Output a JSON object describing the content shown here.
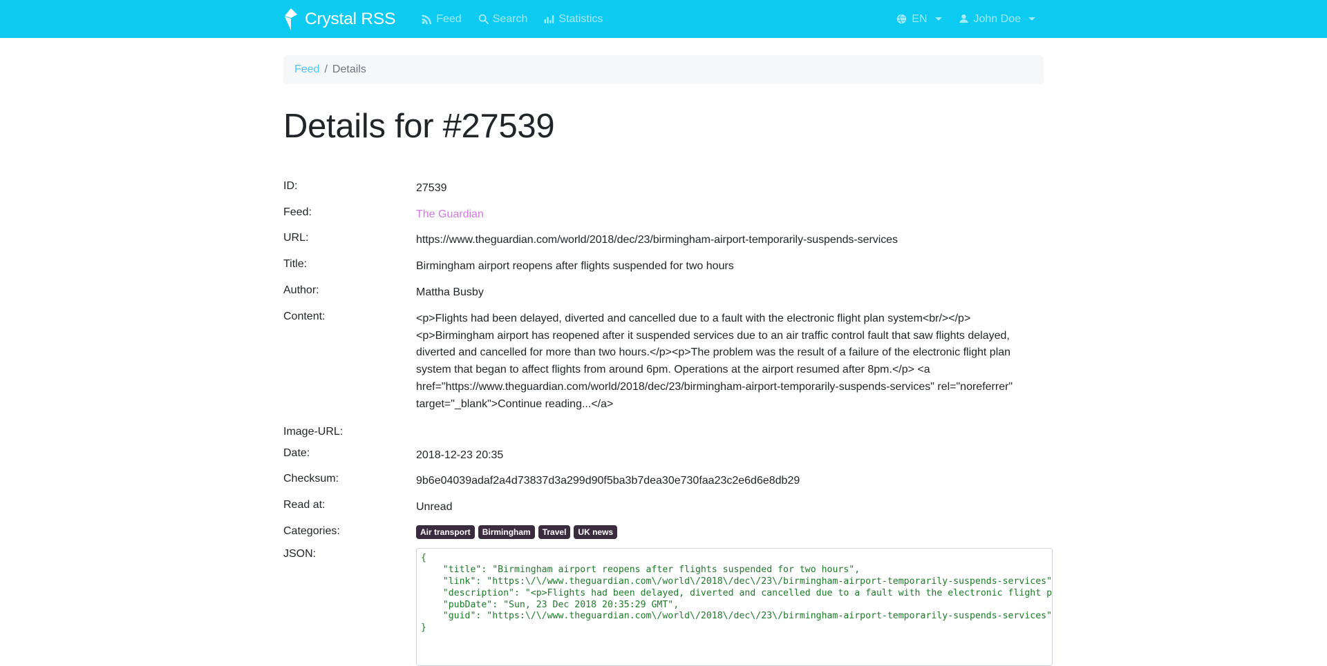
{
  "navbar": {
    "brand": "Crystal RSS",
    "brand_icon": "crystal-logo-icon",
    "links": [
      {
        "label": "Feed",
        "icon": "rss-feed-icon"
      },
      {
        "label": "Search",
        "icon": "search-icon"
      },
      {
        "label": "Statistics",
        "icon": "bar-chart-icon"
      }
    ],
    "language": {
      "label": "EN",
      "icon": "globe-icon"
    },
    "user": {
      "label": "John Doe",
      "icon": "user-icon"
    },
    "background_color": "#0dcaf0"
  },
  "breadcrumb": {
    "parent": "Feed",
    "separator": "/",
    "current": "Details"
  },
  "page": {
    "title": "Details for #27539"
  },
  "details": {
    "labels": {
      "id": "ID:",
      "feed": "Feed:",
      "url": "URL:",
      "title": "Title:",
      "author": "Author:",
      "content": "Content:",
      "image_url": "Image-URL:",
      "date": "Date:",
      "checksum": "Checksum:",
      "read_at": "Read at:",
      "categories": "Categories:",
      "json": "JSON:"
    },
    "id": "27539",
    "feed": "The Guardian",
    "feed_link_color": "#d17ae0",
    "url": "https://www.theguardian.com/world/2018/dec/23/birmingham-airport-temporarily-suspends-services",
    "title": "Birmingham airport reopens after flights suspended for two hours",
    "author": "Mattha Busby",
    "content": "<p>Flights had been delayed, diverted and cancelled due to a fault with the electronic flight plan system<br/></p><p>Birmingham airport has reopened after it suspended services due to an air traffic control fault that saw flights delayed, diverted and cancelled for more than two hours.</p><p>The problem was the result of a failure of the electronic flight plan system that began to affect flights from around 6pm. Operations at the airport resumed after 8pm.</p> <a href=\"https://www.theguardian.com/world/2018/dec/23/birmingham-airport-temporarily-suspends-services\" rel=\"noreferrer\" target=\"_blank\">Continue reading...</a>",
    "image_url": "",
    "date": "2018-12-23 20:35",
    "checksum": "9b6e04039adaf2a4d73837d3a299d90f5ba3b7dea30e730faa23c2e6d6e8db29",
    "read_at": "Unread",
    "categories": [
      "Air transport",
      "Birmingham",
      "Travel",
      "UK news"
    ],
    "json_raw": "{\n    \"title\": \"Birmingham airport reopens after flights suspended for two hours\",\n    \"link\": \"https:\\/\\/www.theguardian.com\\/world\\/2018\\/dec\\/23\\/birmingham-airport-temporarily-suspends-services\",\n    \"description\": \"<p>Flights had been delayed, diverted and cancelled due to a fault with the electronic flight plan\n    \"pubDate\": \"Sun, 23 Dec 2018 20:35:29 GMT\",\n    \"guid\": \"https:\\/\\/www.theguardian.com\\/world\\/2018\\/dec\\/23\\/birmingham-airport-temporarily-suspends-services\"\n}"
  }
}
